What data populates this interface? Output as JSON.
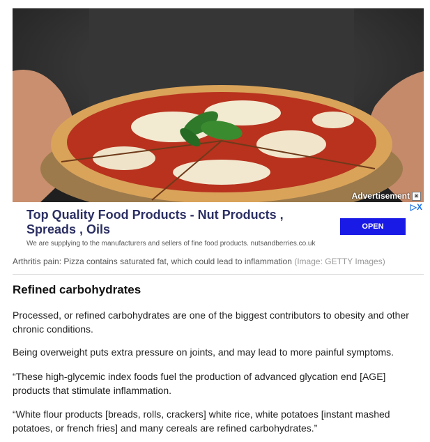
{
  "ad": {
    "label": "Advertisement",
    "close_glyph": "×",
    "adchoices": "▷X",
    "headline": "Top Quality Food Products - Nut Products , Spreads , Oils",
    "subtext": "We are supplying to the manufacturers and sellers of fine food products. nutsandberries.co.uk",
    "cta": "OPEN",
    "cta_color": "#1a1ae6"
  },
  "caption": {
    "text": "Arthritis pain: Pizza contains saturated fat, which could lead to inflammation",
    "credit": "(Image: GETTY Images)"
  },
  "article": {
    "heading": "Refined carbohydrates",
    "paragraphs": [
      "Processed, or refined carbohydrates are one of the biggest contributors to obesity and other chronic conditions.",
      "Being overweight puts extra pressure on joints, and may lead to more painful symptoms.",
      "“These high-glycemic index foods fuel the production of advanced glycation end [AGE] products that stimulate inflammation.",
      "“White flour products [breads, rolls, crackers] white rice, white potatoes [instant mashed potatoes, or french fries] and many cereals are refined carbohydrates.”"
    ]
  }
}
